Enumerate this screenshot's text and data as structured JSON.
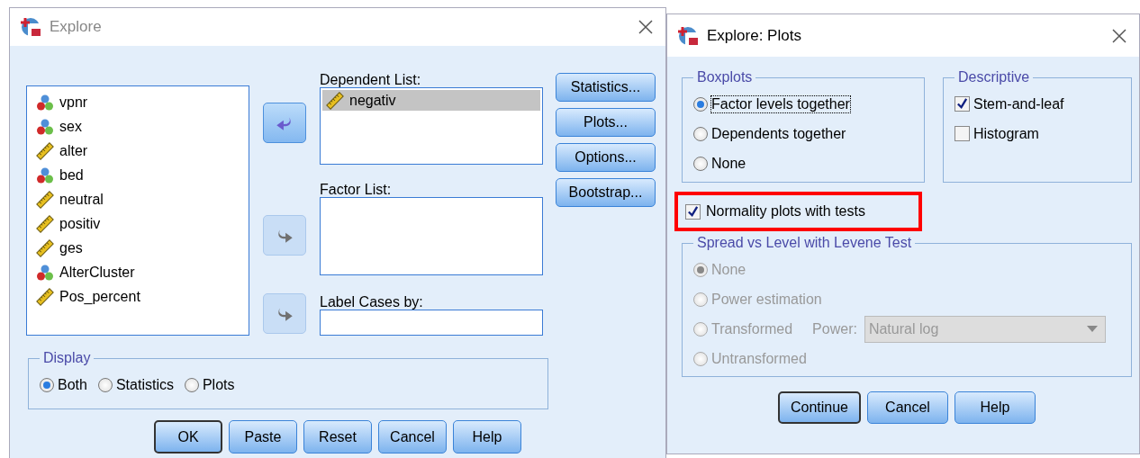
{
  "explore": {
    "title": "Explore",
    "variables": [
      {
        "name": "vpnr",
        "kind": "nominal"
      },
      {
        "name": "sex",
        "kind": "nominal"
      },
      {
        "name": "alter",
        "kind": "scale"
      },
      {
        "name": "bed",
        "kind": "nominal"
      },
      {
        "name": "neutral",
        "kind": "scale"
      },
      {
        "name": "positiv",
        "kind": "scale"
      },
      {
        "name": "ges",
        "kind": "scale"
      },
      {
        "name": "AlterCluster",
        "kind": "nominal"
      },
      {
        "name": "Pos_percent",
        "kind": "scale"
      }
    ],
    "arrows": [
      {
        "kind": "left",
        "disabled": false
      },
      {
        "kind": "right",
        "disabled": true
      },
      {
        "kind": "right",
        "disabled": true
      }
    ],
    "dependent_list": {
      "label": "Dependent List:",
      "items": [
        {
          "name": "negativ",
          "kind": "scale",
          "selected": true
        }
      ]
    },
    "factor_list": {
      "label": "Factor List:"
    },
    "label_cases": {
      "label": "Label Cases by:"
    },
    "side_buttons": [
      "Statistics...",
      "Plots...",
      "Options...",
      "Bootstrap..."
    ],
    "display": {
      "title": "Display",
      "options": [
        {
          "label": "Both",
          "selected": true
        },
        {
          "label": "Statistics",
          "selected": false
        },
        {
          "label": "Plots",
          "selected": false
        }
      ]
    },
    "buttons": [
      {
        "label": "OK",
        "default": true
      },
      {
        "label": "Paste",
        "default": false
      },
      {
        "label": "Reset",
        "default": false
      },
      {
        "label": "Cancel",
        "default": false
      },
      {
        "label": "Help",
        "default": false
      }
    ]
  },
  "plots": {
    "title": "Explore: Plots",
    "boxplots": {
      "title": "Boxplots",
      "options": [
        {
          "label": "Factor levels together",
          "selected": true,
          "focused": true
        },
        {
          "label": "Dependents together",
          "selected": false,
          "focused": false
        },
        {
          "label": "None",
          "selected": false,
          "focused": false
        }
      ]
    },
    "descriptive": {
      "title": "Descriptive",
      "options": [
        {
          "label": "Stem-and-leaf",
          "checked": true
        },
        {
          "label": "Histogram",
          "checked": false
        }
      ]
    },
    "normality": {
      "label": "Normality plots with tests",
      "checked": true,
      "highlighted": true
    },
    "spread": {
      "title": "Spread vs Level with Levene Test",
      "disabled": true,
      "options": [
        {
          "label": "None",
          "selected": true
        },
        {
          "label": "Power estimation",
          "selected": false
        },
        {
          "label": "Transformed",
          "selected": false,
          "power": {
            "label": "Power:",
            "value": "Natural log"
          }
        },
        {
          "label": "Untransformed",
          "selected": false
        }
      ]
    },
    "buttons": [
      {
        "label": "Continue",
        "default": true
      },
      {
        "label": "Cancel",
        "default": false
      },
      {
        "label": "Help",
        "default": false
      }
    ]
  }
}
